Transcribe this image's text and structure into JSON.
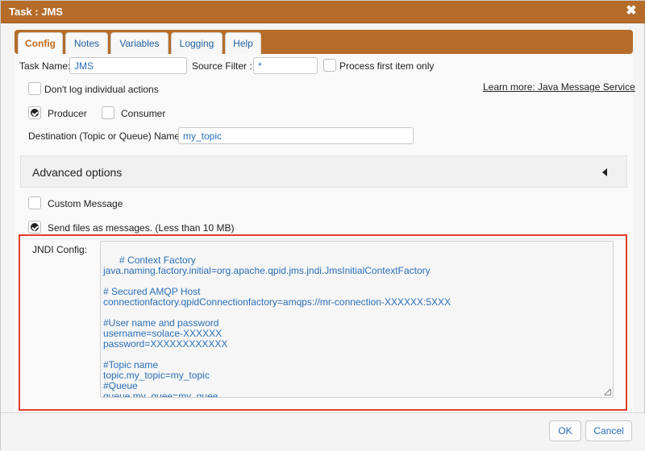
{
  "dialog": {
    "title": "Task : JMS",
    "close_glyph": "✖",
    "close_icon": "close-icon"
  },
  "tabs": [
    {
      "label": "Config",
      "active": true
    },
    {
      "label": "Notes",
      "active": false
    },
    {
      "label": "Variables",
      "active": false
    },
    {
      "label": "Logging",
      "active": false
    },
    {
      "label": "Help",
      "active": false
    }
  ],
  "form": {
    "task_name_label": "Task Name:",
    "task_name_value": "JMS",
    "source_filter_label": "Source Filter :",
    "source_filter_value": "*",
    "process_first_label": "Process first item only",
    "process_first_checked": false,
    "dont_log_label": "Don't log individual actions",
    "dont_log_checked": false,
    "learn_more": "Learn more: Java Message Service",
    "producer_label": "Producer",
    "producer_checked": true,
    "consumer_label": "Consumer",
    "consumer_checked": false,
    "destination_label": "Destination (Topic or Queue) Name:",
    "destination_value": "my_topic",
    "advanced_title": "Advanced options",
    "custom_message_label": "Custom Message",
    "custom_message_checked": false,
    "send_files_label": "Send files as messages. (Less than 10 MB)",
    "send_files_checked": true,
    "jndi_label": "JNDI Config:",
    "jndi_value": "# Context Factory\njava.naming.factory.initial=org.apache.qpid.jms.jndi.JmsInitialContextFactory\n\n# Secured AMQP Host\nconnectionfactory.qpidConnectionfactory=amqps://mr-connection-XXXXXX:5XXX\n\n#User name and password\nusername=solace-XXXXXX\npassword=XXXXXXXXXXXX\n\n#Topic name\ntopic.my_topic=my_topic\n#Queue\nqueue.my_quee=my_quee"
  },
  "footer": {
    "ok_label": "OK",
    "cancel_label": "Cancel"
  },
  "colors": {
    "titlebar": "#b56c2a",
    "accent_tab": "#c06a1a",
    "link_blue": "#2a6fb5",
    "highlight_red": "#e43c2a"
  }
}
